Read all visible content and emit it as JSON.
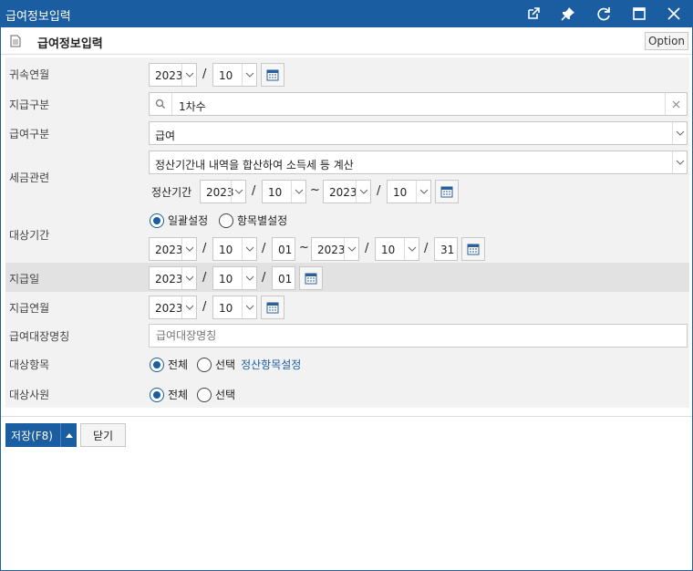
{
  "window": {
    "title": "급여정보입력"
  },
  "header": {
    "title": "급여정보입력",
    "option_label": "Option"
  },
  "labels": {
    "belong_month": "귀속연월",
    "pay_category": "지급구분",
    "salary_type": "급여구분",
    "tax_related": "세금관련",
    "target_period": "대상기간",
    "pay_date": "지급일",
    "pay_month": "지급연월",
    "ledger_name": "급여대장명칭",
    "target_items": "대상항목",
    "target_employees": "대상사원"
  },
  "belong_month": {
    "year": "2023",
    "month": "10"
  },
  "pay_category": {
    "value": "1차수"
  },
  "salary_type": {
    "value": "급여"
  },
  "tax_related": {
    "option": "정산기간내 내역을 합산하여 소득세 등 계산",
    "period_label": "정산기간",
    "from_year": "2023",
    "from_month": "10",
    "to_year": "2023",
    "to_month": "10"
  },
  "target_period": {
    "radio_all": "일괄설정",
    "radio_each": "항목별설정",
    "from_year": "2023",
    "from_month": "10",
    "from_day": "01",
    "to_year": "2023",
    "to_month": "10",
    "to_day": "31"
  },
  "pay_date": {
    "year": "2023",
    "month": "10",
    "day": "01"
  },
  "pay_month": {
    "year": "2023",
    "month": "10"
  },
  "ledger_name": {
    "placeholder": "급여대장명칭",
    "value": ""
  },
  "target_items": {
    "radio_all": "전체",
    "radio_select": "선택",
    "link": "정산항목설정"
  },
  "target_employees": {
    "radio_all": "전체",
    "radio_select": "선택"
  },
  "footer": {
    "save_label": "저장(F8)",
    "close_label": "닫기"
  },
  "colors": {
    "accent": "#1a5da0",
    "form_bg": "#f2f2f2",
    "highlight_row": "#e2e2e2"
  }
}
